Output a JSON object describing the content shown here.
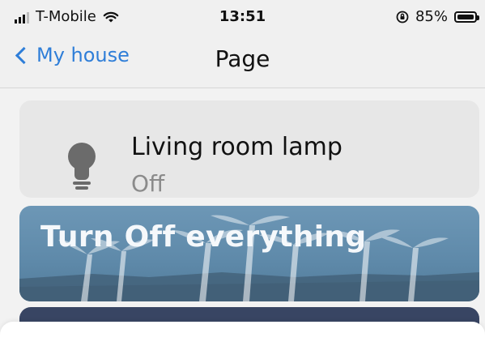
{
  "status": {
    "carrier": "T-Mobile",
    "time": "13:51",
    "battery": "85%"
  },
  "nav": {
    "back_label": "My house",
    "title": "Page"
  },
  "device": {
    "name": "Living room lamp",
    "state": "Off",
    "icon": "lightbulb-icon"
  },
  "scene": {
    "title": "Turn Off everything"
  },
  "colors": {
    "accent": "#2f7ed8",
    "scene_blue": "#5f8aaa",
    "next_card": "#384563"
  }
}
